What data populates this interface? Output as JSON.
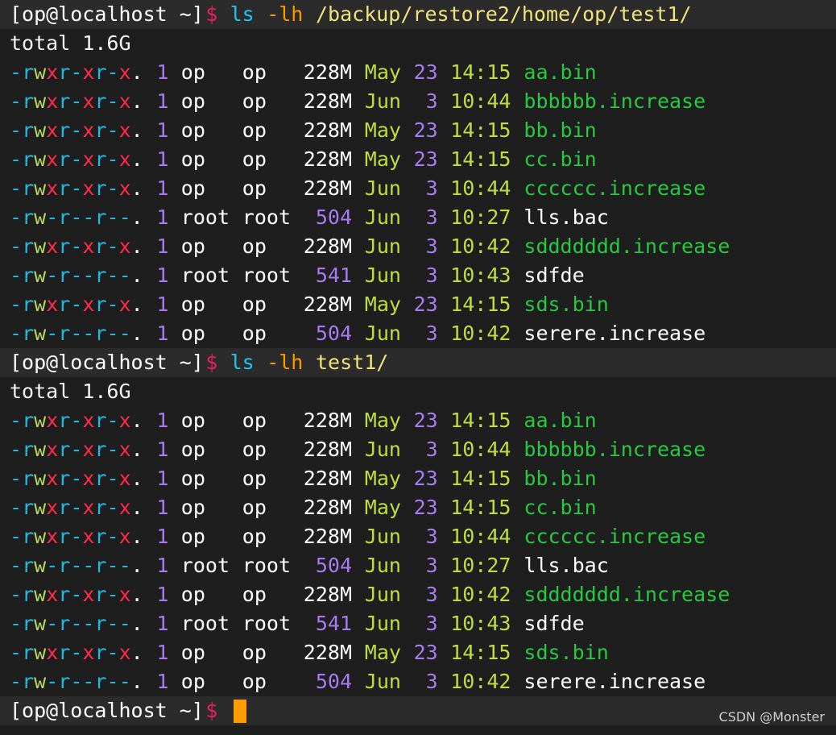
{
  "prompts": [
    {
      "prefix": "[op@localhost ~]",
      "dollar": "$",
      "cmd": "ls",
      "flag": "-lh",
      "arg": "/backup/restore2/home/op/test1/"
    },
    {
      "prefix": "[op@localhost ~]",
      "dollar": "$",
      "cmd": "ls",
      "flag": "-lh",
      "arg": "test1/"
    },
    {
      "prefix": "[op@localhost ~]",
      "dollar": "$",
      "cmd": "",
      "flag": "",
      "arg": ""
    }
  ],
  "total_line": "total 1.6G",
  "listing": [
    {
      "perms": "-rwxr-xr-x.",
      "links": "1",
      "user": "op",
      "group": "op",
      "size": "228M",
      "month": "May",
      "day": "23",
      "time": "14:15",
      "name": "aa.bin",
      "exec": true
    },
    {
      "perms": "-rwxr-xr-x.",
      "links": "1",
      "user": "op",
      "group": "op",
      "size": "228M",
      "month": "Jun",
      "day": "3",
      "time": "10:44",
      "name": "bbbbbb.increase",
      "exec": true
    },
    {
      "perms": "-rwxr-xr-x.",
      "links": "1",
      "user": "op",
      "group": "op",
      "size": "228M",
      "month": "May",
      "day": "23",
      "time": "14:15",
      "name": "bb.bin",
      "exec": true
    },
    {
      "perms": "-rwxr-xr-x.",
      "links": "1",
      "user": "op",
      "group": "op",
      "size": "228M",
      "month": "May",
      "day": "23",
      "time": "14:15",
      "name": "cc.bin",
      "exec": true
    },
    {
      "perms": "-rwxr-xr-x.",
      "links": "1",
      "user": "op",
      "group": "op",
      "size": "228M",
      "month": "Jun",
      "day": "3",
      "time": "10:44",
      "name": "cccccc.increase",
      "exec": true
    },
    {
      "perms": "-rw-r--r--.",
      "links": "1",
      "user": "root",
      "group": "root",
      "size": "504",
      "month": "Jun",
      "day": "3",
      "time": "10:27",
      "name": "lls.bac",
      "exec": false
    },
    {
      "perms": "-rwxr-xr-x.",
      "links": "1",
      "user": "op",
      "group": "op",
      "size": "228M",
      "month": "Jun",
      "day": "3",
      "time": "10:42",
      "name": "sddddddd.increase",
      "exec": true
    },
    {
      "perms": "-rw-r--r--.",
      "links": "1",
      "user": "root",
      "group": "root",
      "size": "541",
      "month": "Jun",
      "day": "3",
      "time": "10:43",
      "name": "sdfde",
      "exec": false
    },
    {
      "perms": "-rwxr-xr-x.",
      "links": "1",
      "user": "op",
      "group": "op",
      "size": "228M",
      "month": "May",
      "day": "23",
      "time": "14:15",
      "name": "sds.bin",
      "exec": true
    },
    {
      "perms": "-rw-r--r--.",
      "links": "1",
      "user": "op",
      "group": "op",
      "size": "504",
      "month": "Jun",
      "day": "3",
      "time": "10:42",
      "name": "serere.increase",
      "exec": false
    }
  ],
  "watermark": "CSDN @Monster",
  "colors": {
    "background": "#1e1e1e",
    "prompt_dollar": "#e8225a",
    "command": "#22c7f0",
    "flag": "#ff9700",
    "argument": "#f2e27a",
    "exec_file": "#28c840",
    "cursor": "#ff9c00"
  }
}
